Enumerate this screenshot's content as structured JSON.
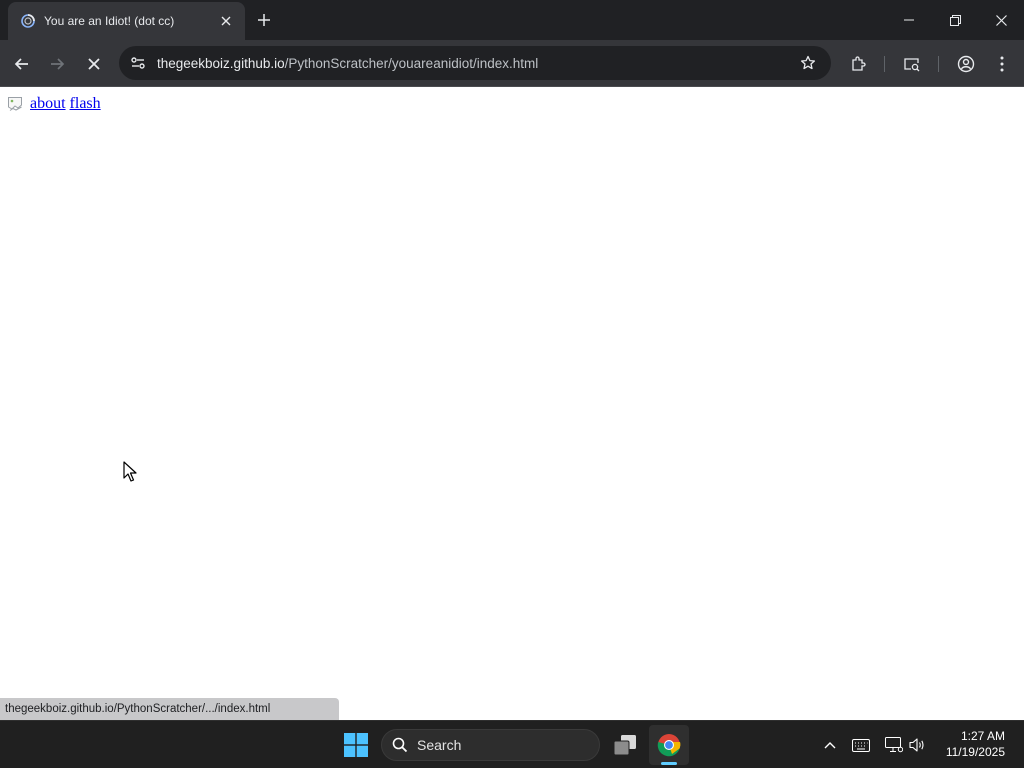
{
  "browser": {
    "tab": {
      "title": "You are an Idiot! (dot cc)"
    },
    "address_bar": {
      "host": "thegeekboiz.github.io",
      "path": "/PythonScratcher/youareanidiot/index.html"
    }
  },
  "page": {
    "links": [
      {
        "label": "about"
      },
      {
        "label": "flash"
      }
    ],
    "status_text": "thegeekboiz.github.io/PythonScratcher/.../index.html"
  },
  "taskbar": {
    "search_label": "Search",
    "clock": {
      "time": "1:27 AM",
      "date": "11/19/2025"
    }
  },
  "colors": {
    "tab_strip": "#202124",
    "toolbar": "#35363a",
    "link": "#0000ee",
    "taskbar": "#202020",
    "active_indicator": "#60cdff"
  },
  "icons": {
    "tab_favicon": "spinner-globe-icon",
    "toolbar": [
      "back-arrow-icon",
      "forward-arrow-icon",
      "stop-icon",
      "site-info-icon",
      "star-icon",
      "extensions-icon",
      "tab-search-icon",
      "profile-icon",
      "kebab-menu-icon"
    ],
    "taskbar": [
      "windows-start-icon",
      "search-icon",
      "task-view-icon",
      "chrome-icon"
    ],
    "tray": [
      "chevron-up-icon",
      "keyboard-icon",
      "network-icon",
      "volume-icon"
    ]
  }
}
